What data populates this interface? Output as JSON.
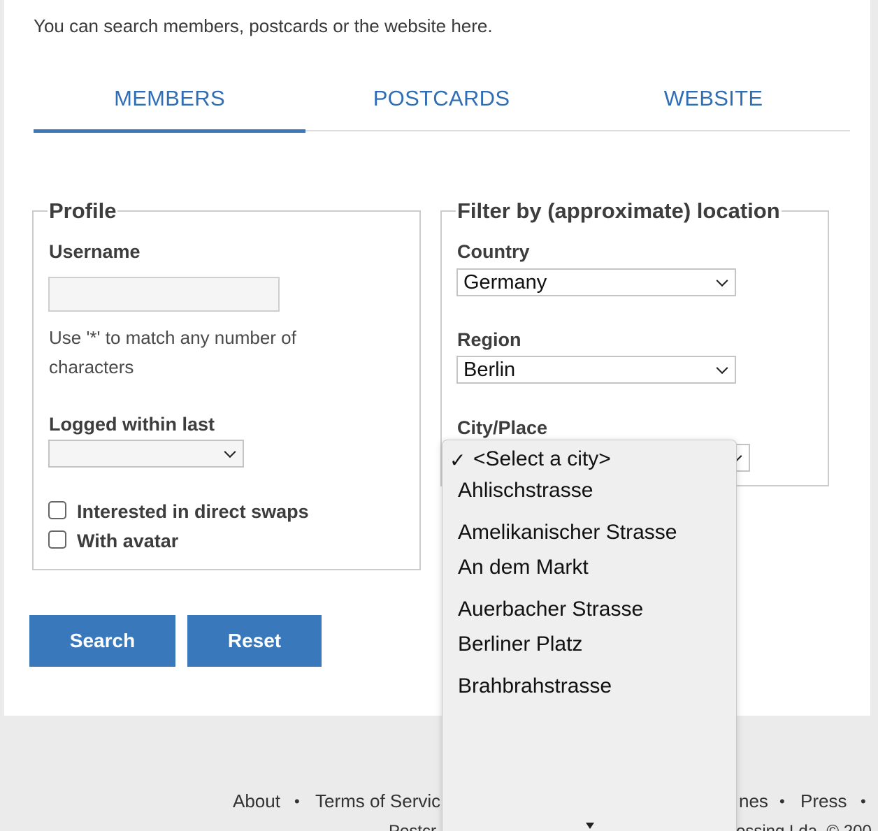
{
  "intro": "You can search members, postcards or the website here.",
  "tabs": [
    {
      "label": "MEMBERS",
      "active": true
    },
    {
      "label": "POSTCARDS",
      "active": false
    },
    {
      "label": "WEBSITE",
      "active": false
    }
  ],
  "profile": {
    "legend": "Profile",
    "username_label": "Username",
    "username_value": "",
    "help_line1": "Use '*' to match any number of",
    "help_line2": "characters",
    "logged_label": "Logged within last",
    "logged_value": "",
    "checkbox_swaps": "Interested in direct swaps",
    "checkbox_avatar": "With avatar"
  },
  "location": {
    "legend": "Filter by (approximate) location",
    "country_label": "Country",
    "country_value": "Germany",
    "region_label": "Region",
    "region_value": "Berlin",
    "city_label": "City/Place"
  },
  "buttons": {
    "search": "Search",
    "reset": "Reset"
  },
  "city_dropdown": {
    "selected": "<Select a city>",
    "options": [
      "<Select a city>",
      "Ahlischstrasse",
      "Amelikanischer Strasse",
      "An dem Markt",
      "Auerbacher Strasse",
      "Berliner Platz",
      "Brahbrahstrasse"
    ]
  },
  "footer": {
    "about": "About",
    "terms": "Terms of Servic",
    "guidelines_partial": "nes",
    "press": "Press",
    "line2_left": "Postcr",
    "line2_right": "rossing Lda. © 200"
  },
  "colors": {
    "accent": "#3a78bc",
    "tab_text": "#2f6db5",
    "footer_bg": "#ebebeb"
  }
}
